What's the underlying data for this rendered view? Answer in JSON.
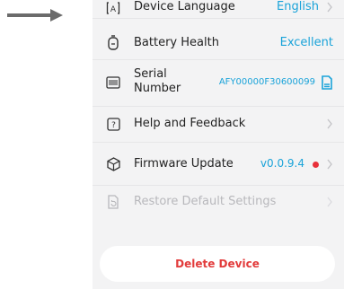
{
  "settings": {
    "language": {
      "label": "Device Language",
      "value": "English",
      "icon": "language-icon"
    },
    "battery": {
      "label": "Battery Health",
      "value": "Excellent",
      "icon": "battery-icon"
    },
    "serial": {
      "label_line1": "Serial",
      "label_line2": "Number",
      "value": "AFY00000F30600099",
      "icon": "barcode-icon",
      "action_icon": "copy-icon"
    },
    "help": {
      "label": "Help and Feedback",
      "icon": "help-icon"
    },
    "firmware": {
      "label": "Firmware Update",
      "value": "v0.0.9.4",
      "icon": "cube-icon",
      "update_available": true
    },
    "restore": {
      "label": "Restore Default Settings",
      "icon": "restore-icon",
      "disabled": true
    }
  },
  "actions": {
    "delete_label": "Delete Device"
  },
  "colors": {
    "accent": "#1aa3d9",
    "danger": "#e23b3b",
    "dot": "#e8303a",
    "panel_bg": "#f3f3f4"
  }
}
